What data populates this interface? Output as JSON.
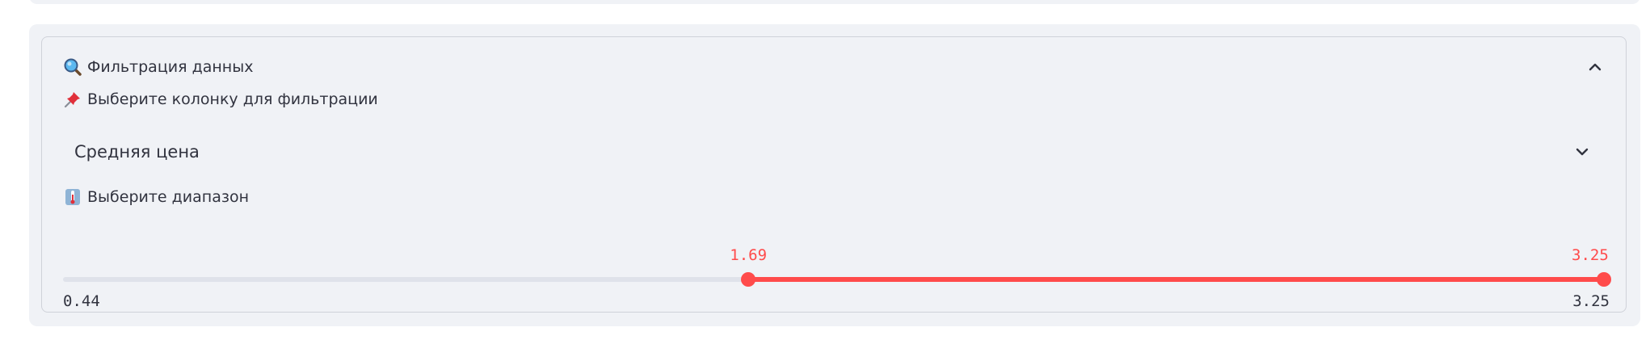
{
  "expander": {
    "icon": "magnifying-glass-icon",
    "title": "Фильтрация данных",
    "expanded": true
  },
  "column_select": {
    "icon": "pushpin-icon",
    "label": "Выберите колонку для фильтрации",
    "value": "Средняя цена"
  },
  "range_slider": {
    "icon": "thermometer-icon",
    "label": "Выберите диапазон",
    "min": 0.44,
    "max": 3.25,
    "low": 1.69,
    "high": 3.25,
    "min_text": "0.44",
    "max_text": "3.25",
    "low_text": "1.69",
    "high_text": "3.25",
    "accent_color": "#ff4b4b",
    "track_color": "#dfe2ea"
  }
}
